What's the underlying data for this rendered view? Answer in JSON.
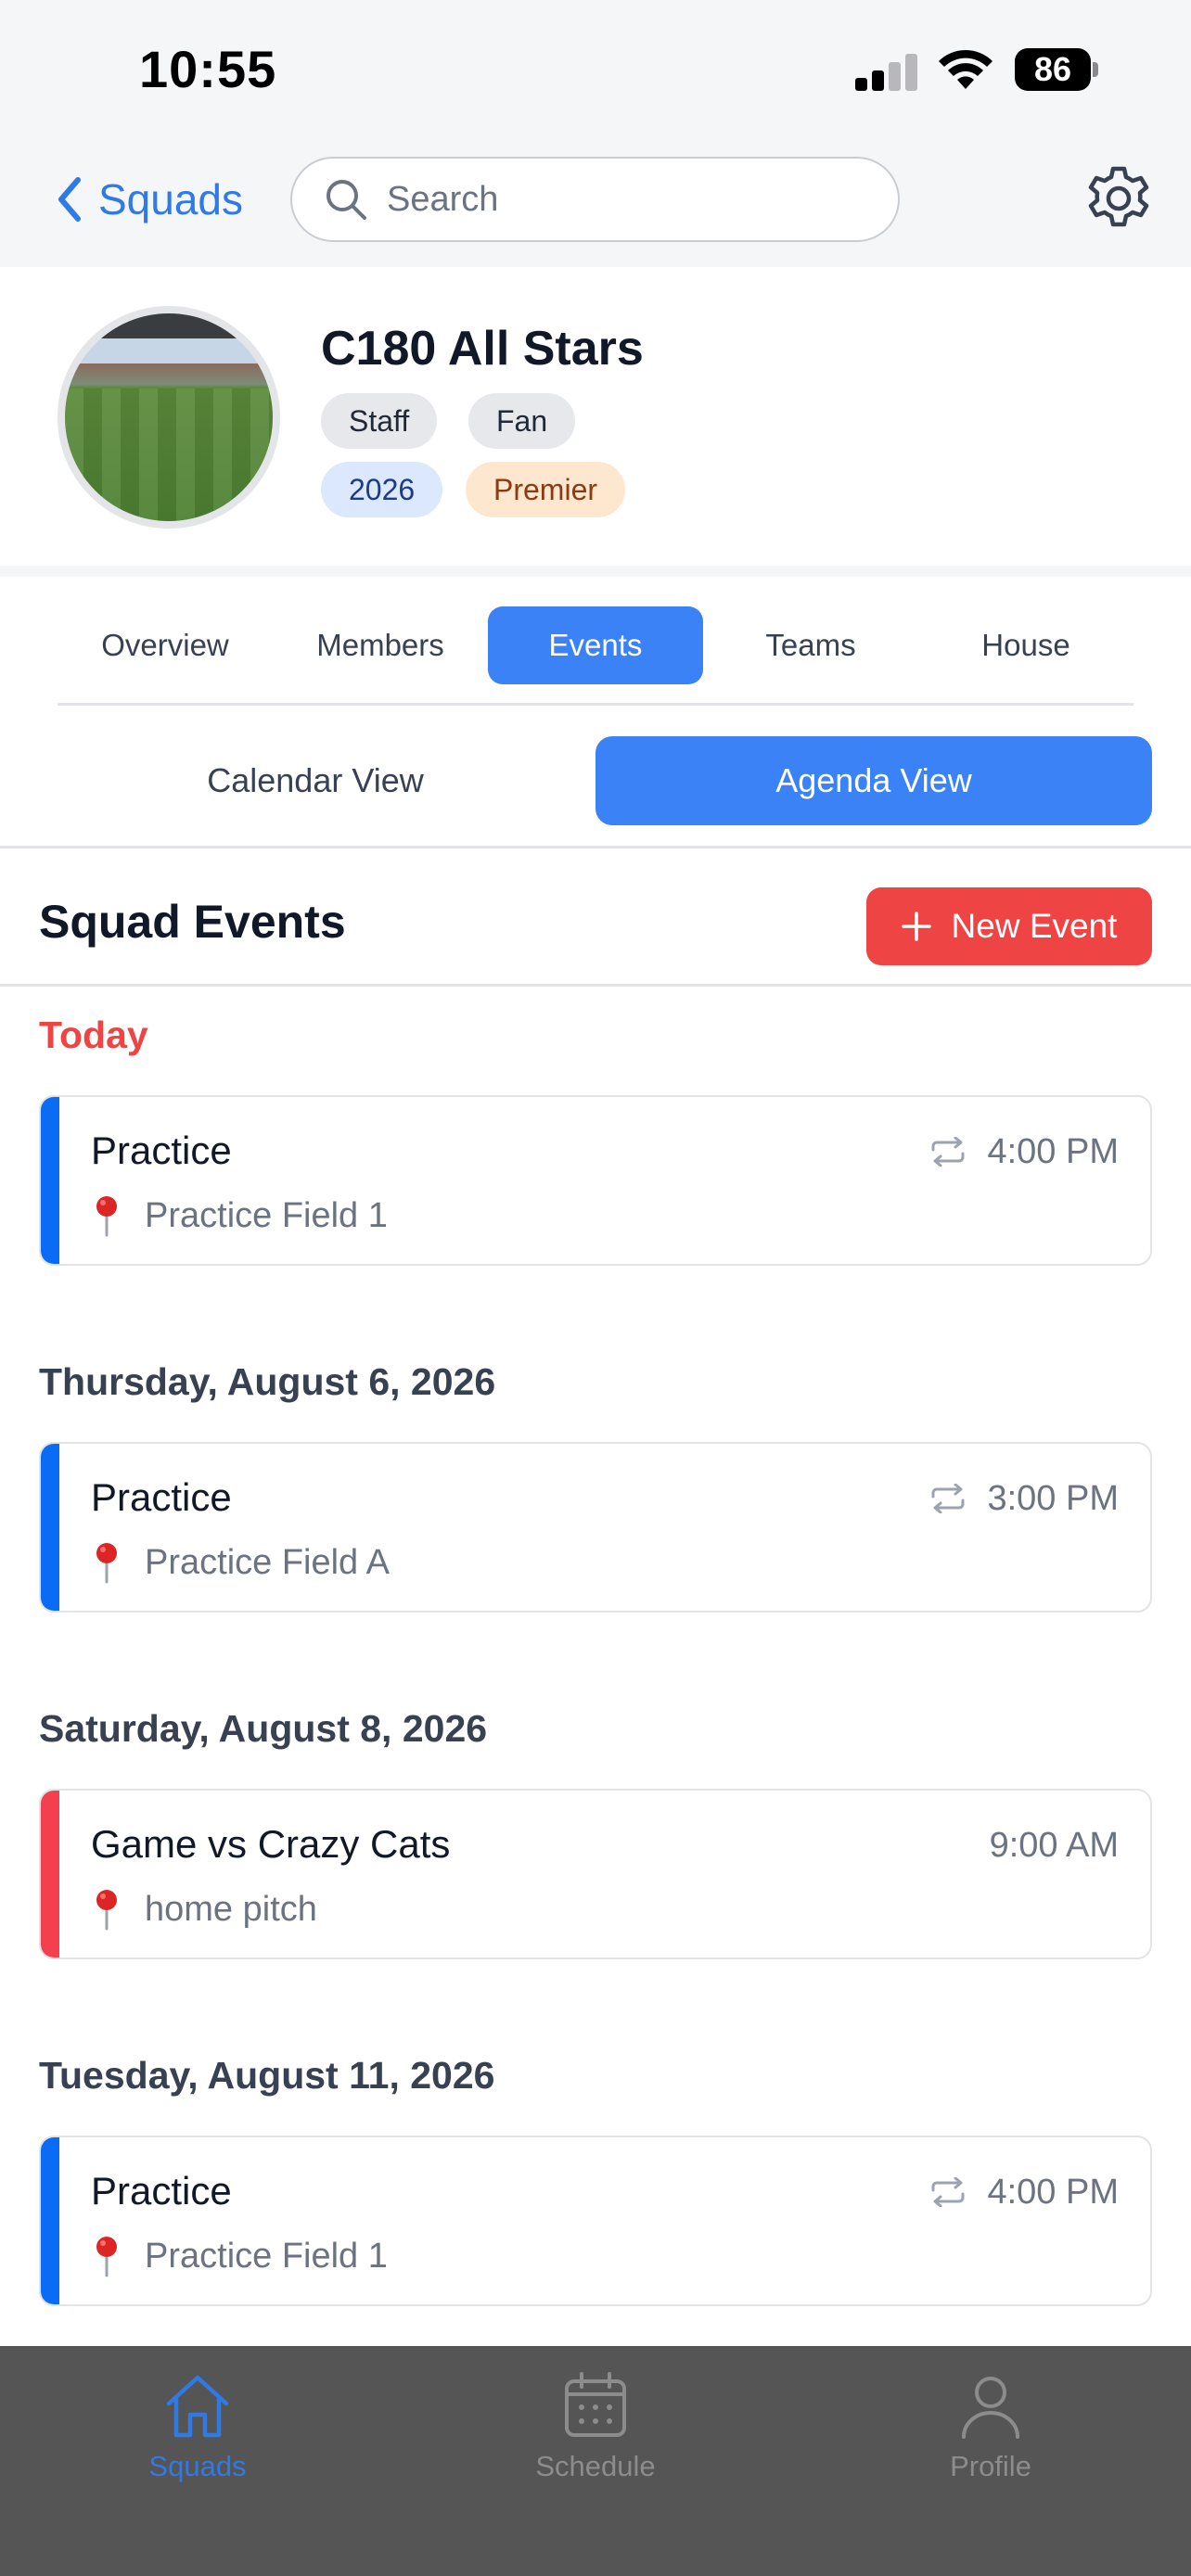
{
  "status_bar": {
    "time": "10:55",
    "battery": "86"
  },
  "nav": {
    "back_label": "Squads",
    "search_placeholder": "Search"
  },
  "squad": {
    "name": "C180 All Stars",
    "badges": [
      "Staff",
      "Fan",
      "2026",
      "Premier"
    ]
  },
  "tabs": [
    {
      "label": "Overview",
      "active": false
    },
    {
      "label": "Members",
      "active": false
    },
    {
      "label": "Events",
      "active": true
    },
    {
      "label": "Teams",
      "active": false
    },
    {
      "label": "House",
      "active": false
    }
  ],
  "view_toggle": {
    "calendar": "Calendar View",
    "agenda": "Agenda View",
    "active": "agenda"
  },
  "events_section": {
    "title": "Squad Events",
    "new_event_label": "New Event"
  },
  "event_groups": [
    {
      "heading": "Today",
      "events": [
        {
          "title": "Practice",
          "location": "Practice Field 1",
          "time": "4:00 PM",
          "recurring": true,
          "color": "#0a6cf5"
        }
      ]
    },
    {
      "heading": "Thursday, August 6, 2026",
      "events": [
        {
          "title": "Practice",
          "location": "Practice Field A",
          "time": "3:00 PM",
          "recurring": true,
          "color": "#0a6cf5"
        }
      ]
    },
    {
      "heading": "Saturday, August 8, 2026",
      "events": [
        {
          "title": "Game vs Crazy Cats",
          "location": "home pitch",
          "time": "9:00 AM",
          "recurring": false,
          "color": "#f43f4e"
        }
      ]
    },
    {
      "heading": "Tuesday, August 11, 2026",
      "events": [
        {
          "title": "Practice",
          "location": "Practice Field 1",
          "time": "4:00 PM",
          "recurring": true,
          "color": "#0a6cf5"
        }
      ]
    }
  ],
  "bottom_tabs": [
    {
      "label": "Squads",
      "icon": "home-icon",
      "active": true
    },
    {
      "label": "Schedule",
      "icon": "calendar-icon",
      "active": false
    },
    {
      "label": "Profile",
      "icon": "person-icon",
      "active": false
    }
  ],
  "colors": {
    "accent": "#3b82f6",
    "danger": "#ef4444",
    "link": "#2f7ae5"
  }
}
